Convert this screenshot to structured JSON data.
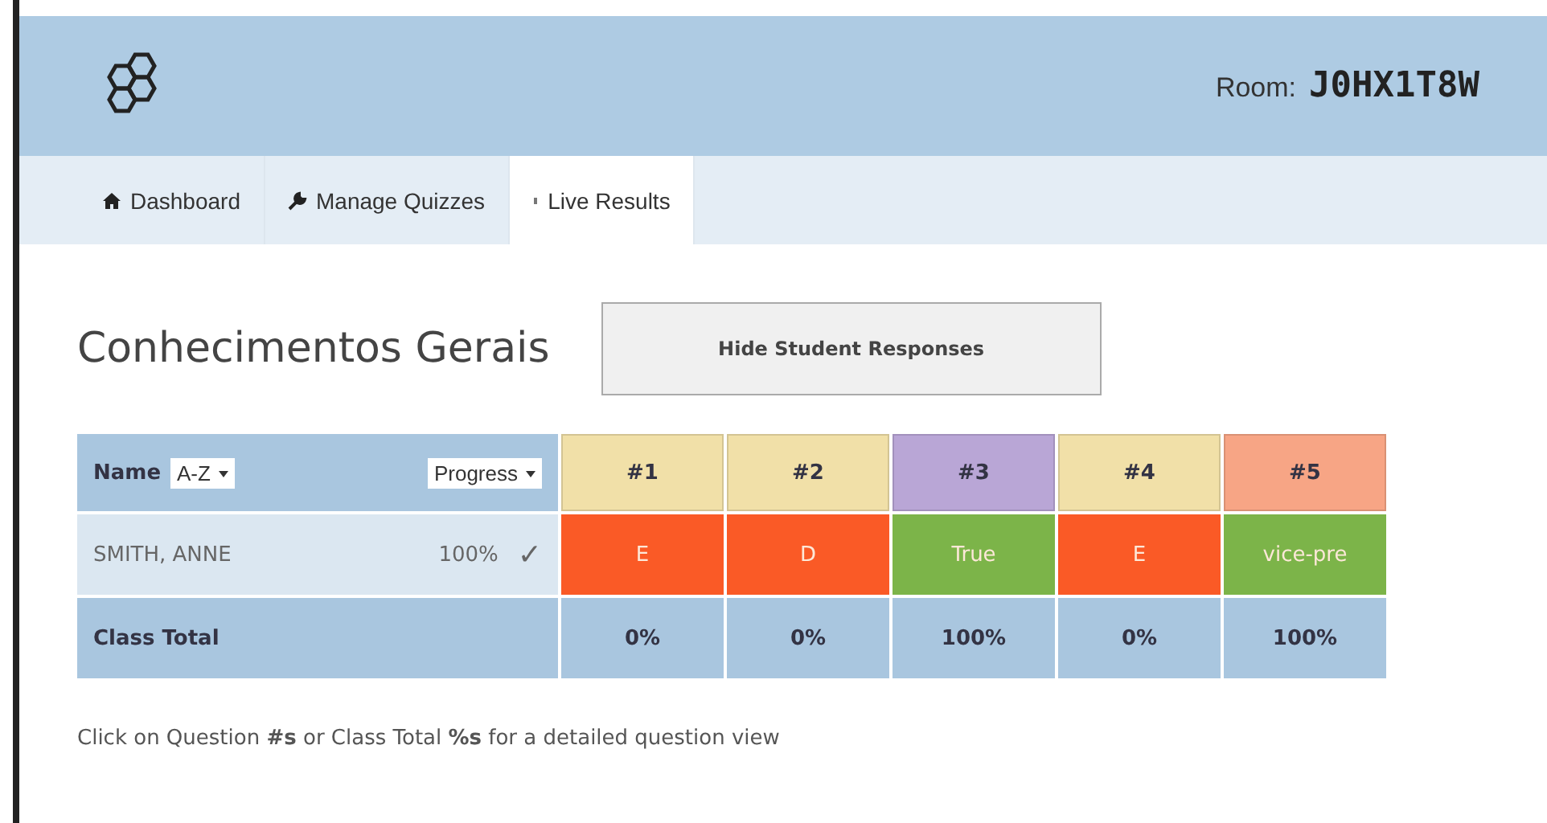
{
  "header": {
    "room_label": "Room:",
    "room_code": "J0HX1T8W"
  },
  "nav": [
    {
      "label": "Dashboard",
      "kind": "home",
      "selected": false
    },
    {
      "label": "Manage Quizzes",
      "kind": "wrench",
      "selected": false
    },
    {
      "label": "Live Results",
      "kind": "dot",
      "selected": true
    }
  ],
  "quiz_title": "Conhecimentos Gerais",
  "hide_button": "Hide Student Responses",
  "table": {
    "name_label": "Name",
    "sort_select": "A-Z",
    "progress_select": "Progress",
    "questions": [
      {
        "label": "#1",
        "color": "#f1e0a8"
      },
      {
        "label": "#2",
        "color": "#f1e0a8"
      },
      {
        "label": "#3",
        "color": "#b9a6d6"
      },
      {
        "label": "#4",
        "color": "#f1e0a8"
      },
      {
        "label": "#5",
        "color": "#f7a585"
      }
    ],
    "students": [
      {
        "name": "SMITH, ANNE",
        "progress": "100%",
        "check": "✓",
        "answers": [
          {
            "text": "E",
            "correct": false
          },
          {
            "text": "D",
            "correct": false
          },
          {
            "text": "True",
            "correct": true
          },
          {
            "text": "E",
            "correct": false
          },
          {
            "text": "vice-pre",
            "correct": true
          }
        ]
      }
    ],
    "total_label": "Class Total",
    "totals": [
      "0%",
      "0%",
      "100%",
      "0%",
      "100%"
    ]
  },
  "hint": "Click on Question **#s** or Class Total **%s** for a detailed question view"
}
